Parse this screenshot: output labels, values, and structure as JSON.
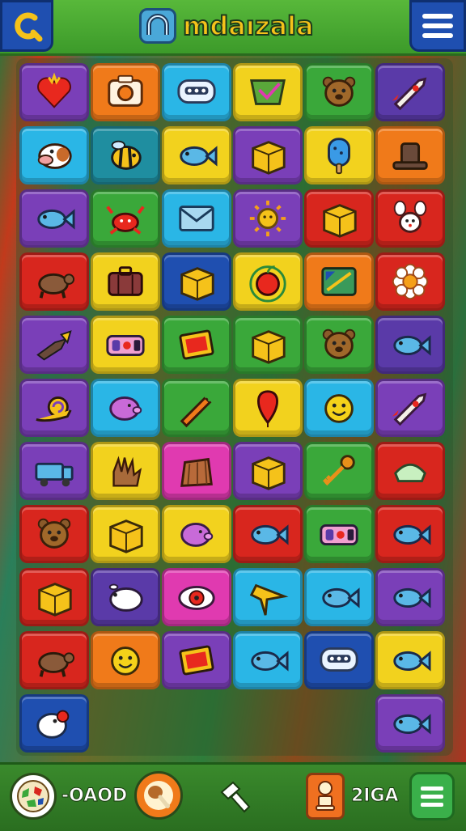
{
  "header": {
    "title": "mdaızala",
    "back_icon": "c-back-icon",
    "menu_icon": "hamburger-menu-icon"
  },
  "board": {
    "columns": 6,
    "rows": [
      [
        {
          "color": "#7a3fb8",
          "icon": "heart"
        },
        {
          "color": "#f07a1a",
          "icon": "camera"
        },
        {
          "color": "#2ab6e6",
          "icon": "robot-face"
        },
        {
          "color": "#f2d21e",
          "icon": "envelope-check"
        },
        {
          "color": "#3aa83a",
          "icon": "bear-head"
        },
        {
          "color": "#5a3aa8",
          "icon": "rocket"
        }
      ],
      [
        {
          "color": "#2ab6e6",
          "icon": "cow"
        },
        {
          "color": "#1f8ea0",
          "icon": "bee"
        },
        {
          "color": "#f2d21e",
          "icon": "fish"
        },
        {
          "color": "#7a3fb8",
          "icon": "box"
        },
        {
          "color": "#f2d21e",
          "icon": "popsicle"
        },
        {
          "color": "#f07a1a",
          "icon": "hat"
        }
      ],
      [
        {
          "color": "#7a3fb8",
          "icon": "fish"
        },
        {
          "color": "#3aa83a",
          "icon": "crab"
        },
        {
          "color": "#2ab6e6",
          "icon": "envelope"
        },
        {
          "color": "#7a3fb8",
          "icon": "sun"
        },
        {
          "color": "#d8261e",
          "icon": "box"
        },
        {
          "color": "#d8261e",
          "icon": "bunny"
        }
      ],
      [
        {
          "color": "#d8261e",
          "icon": "turtle"
        },
        {
          "color": "#f2d21e",
          "icon": "suitcase"
        },
        {
          "color": "#1f4fb0",
          "icon": "box"
        },
        {
          "color": "#f2d21e",
          "icon": "apple"
        },
        {
          "color": "#f07a1a",
          "icon": "tv"
        },
        {
          "color": "#d8261e",
          "icon": "flower"
        }
      ],
      [
        {
          "color": "#7a3fb8",
          "icon": "bird"
        },
        {
          "color": "#f2d21e",
          "icon": "radio"
        },
        {
          "color": "#3aa83a",
          "icon": "frame"
        },
        {
          "color": "#3aa83a",
          "icon": "box"
        },
        {
          "color": "#3aa83a",
          "icon": "bear-head"
        },
        {
          "color": "#5a3aa8",
          "icon": "fish"
        }
      ],
      [
        {
          "color": "#7a3fb8",
          "icon": "snail"
        },
        {
          "color": "#2ab6e6",
          "icon": "pig"
        },
        {
          "color": "#3aa83a",
          "icon": "carrot"
        },
        {
          "color": "#f2d21e",
          "icon": "balloon"
        },
        {
          "color": "#2ab6e6",
          "icon": "smiley"
        },
        {
          "color": "#7a3fb8",
          "icon": "rocket"
        }
      ],
      [
        {
          "color": "#7a3fb8",
          "icon": "truck"
        },
        {
          "color": "#f2d21e",
          "icon": "hand"
        },
        {
          "color": "#e03ab0",
          "icon": "stump"
        },
        {
          "color": "#7a3fb8",
          "icon": "box"
        },
        {
          "color": "#3aa83a",
          "icon": "key"
        },
        {
          "color": "#d8261e",
          "icon": "bowl"
        }
      ],
      [
        {
          "color": "#d8261e",
          "icon": "bear-head"
        },
        {
          "color": "#f2d21e",
          "icon": "box"
        },
        {
          "color": "#f2d21e",
          "icon": "pig"
        },
        {
          "color": "#d8261e",
          "icon": "fish"
        },
        {
          "color": "#3aa83a",
          "icon": "radio"
        },
        {
          "color": "#d8261e",
          "icon": "fish"
        }
      ],
      [
        {
          "color": "#d8261e",
          "icon": "box"
        },
        {
          "color": "#5a3aa8",
          "icon": "sheep"
        },
        {
          "color": "#e03ab0",
          "icon": "eye"
        },
        {
          "color": "#2ab6e6",
          "icon": "star"
        },
        {
          "color": "#2ab6e6",
          "icon": "fish"
        },
        {
          "color": "#7a3fb8",
          "icon": "fish"
        }
      ],
      [
        {
          "color": "#d8261e",
          "icon": "turtle"
        },
        {
          "color": "#f07a1a",
          "icon": "smiley"
        },
        {
          "color": "#7a3fb8",
          "icon": "frame"
        },
        {
          "color": "#2ab6e6",
          "icon": "fish"
        },
        {
          "color": "#1f4fb0",
          "icon": "robot-face"
        },
        {
          "color": "#f2d21e",
          "icon": "fish"
        }
      ],
      [
        {
          "color": "#1f4fb0",
          "icon": "chick"
        },
        null,
        null,
        null,
        null,
        {
          "color": "#7a3fb8",
          "icon": "fish"
        }
      ]
    ]
  },
  "footer": {
    "left_icon": "map-icon",
    "left_value": "-OAOD",
    "center_icon": "drumstick-icon",
    "hint_icon": "hammer-icon",
    "right_icon": "trophy-icon",
    "right_value": "2IGA",
    "menu_icon": "list-menu-icon"
  },
  "colors": {
    "topbar": "#4aa83a",
    "title": "#f5c21a",
    "button_blue": "#1f4fb0"
  }
}
